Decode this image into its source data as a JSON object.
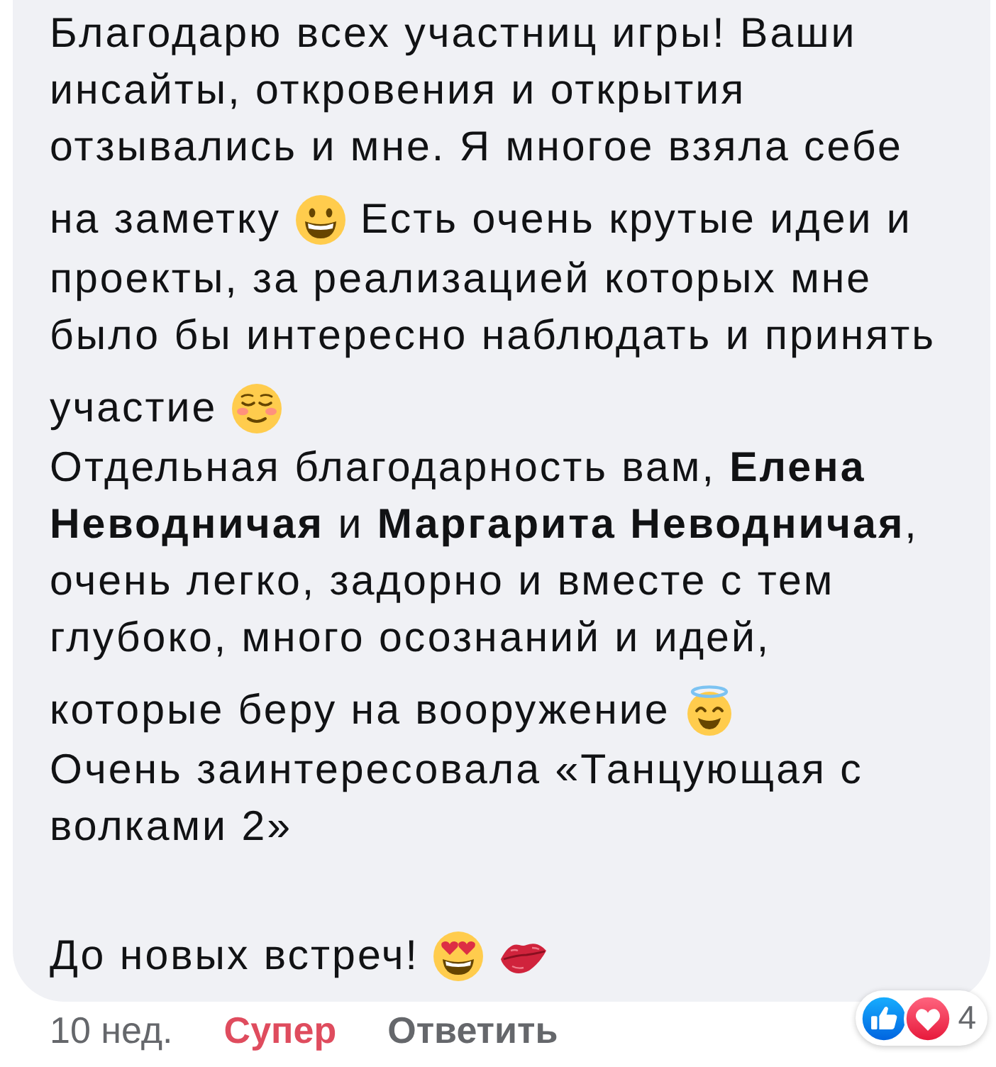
{
  "comment": {
    "paragraphs": [
      {
        "lines": [
          [
            {
              "kind": "text",
              "text": "Благодарю всех участниц игры! Ваши"
            }
          ],
          [
            {
              "kind": "text",
              "text": "инсайты, откровения и открытия"
            }
          ],
          [
            {
              "kind": "text",
              "text": "отзывались и мне. Я многое взяла себе"
            }
          ],
          [
            {
              "kind": "text",
              "text": "на заметку"
            },
            {
              "kind": "grin"
            },
            {
              "kind": "text",
              "text": "Есть очень крутые идеи и"
            }
          ],
          [
            {
              "kind": "text",
              "text": "проекты, за реализацией которых мне"
            }
          ],
          [
            {
              "kind": "text",
              "text": "было бы интересно наблюдать и принять"
            }
          ],
          [
            {
              "kind": "text",
              "text": "участие"
            },
            {
              "kind": "blush"
            }
          ],
          [
            {
              "kind": "text",
              "text": "Отдельная благодарность вам, **Елена**"
            }
          ],
          [
            {
              "kind": "text",
              "text": "**Неводничая** и **Маргарита Неводничая**,"
            }
          ],
          [
            {
              "kind": "text",
              "text": "очень легко, задорно и вместе с тем"
            }
          ],
          [
            {
              "kind": "text",
              "text": "глубоко, много осознаний и идей,"
            }
          ],
          [
            {
              "kind": "text",
              "text": "которые беру на вооружение"
            },
            {
              "kind": "halo"
            }
          ],
          [
            {
              "kind": "text",
              "text": "Очень заинтересовала «Танцующая с"
            }
          ],
          [
            {
              "kind": "text",
              "text": "волками 2»"
            }
          ]
        ]
      },
      {
        "lines": [
          [
            {
              "kind": "text",
              "text": "До новых встреч!"
            },
            {
              "kind": "hearteyes"
            },
            {
              "kind": "kiss"
            }
          ]
        ]
      }
    ],
    "time": "10 нед.",
    "actions": [
      {
        "kind": "react",
        "label": "Супер",
        "active": true
      },
      {
        "kind": "reply",
        "label": "Ответить",
        "active": false
      }
    ],
    "reactions": {
      "icons": [
        {
          "kind": "like"
        },
        {
          "kind": "love"
        }
      ],
      "count": "4"
    }
  }
}
